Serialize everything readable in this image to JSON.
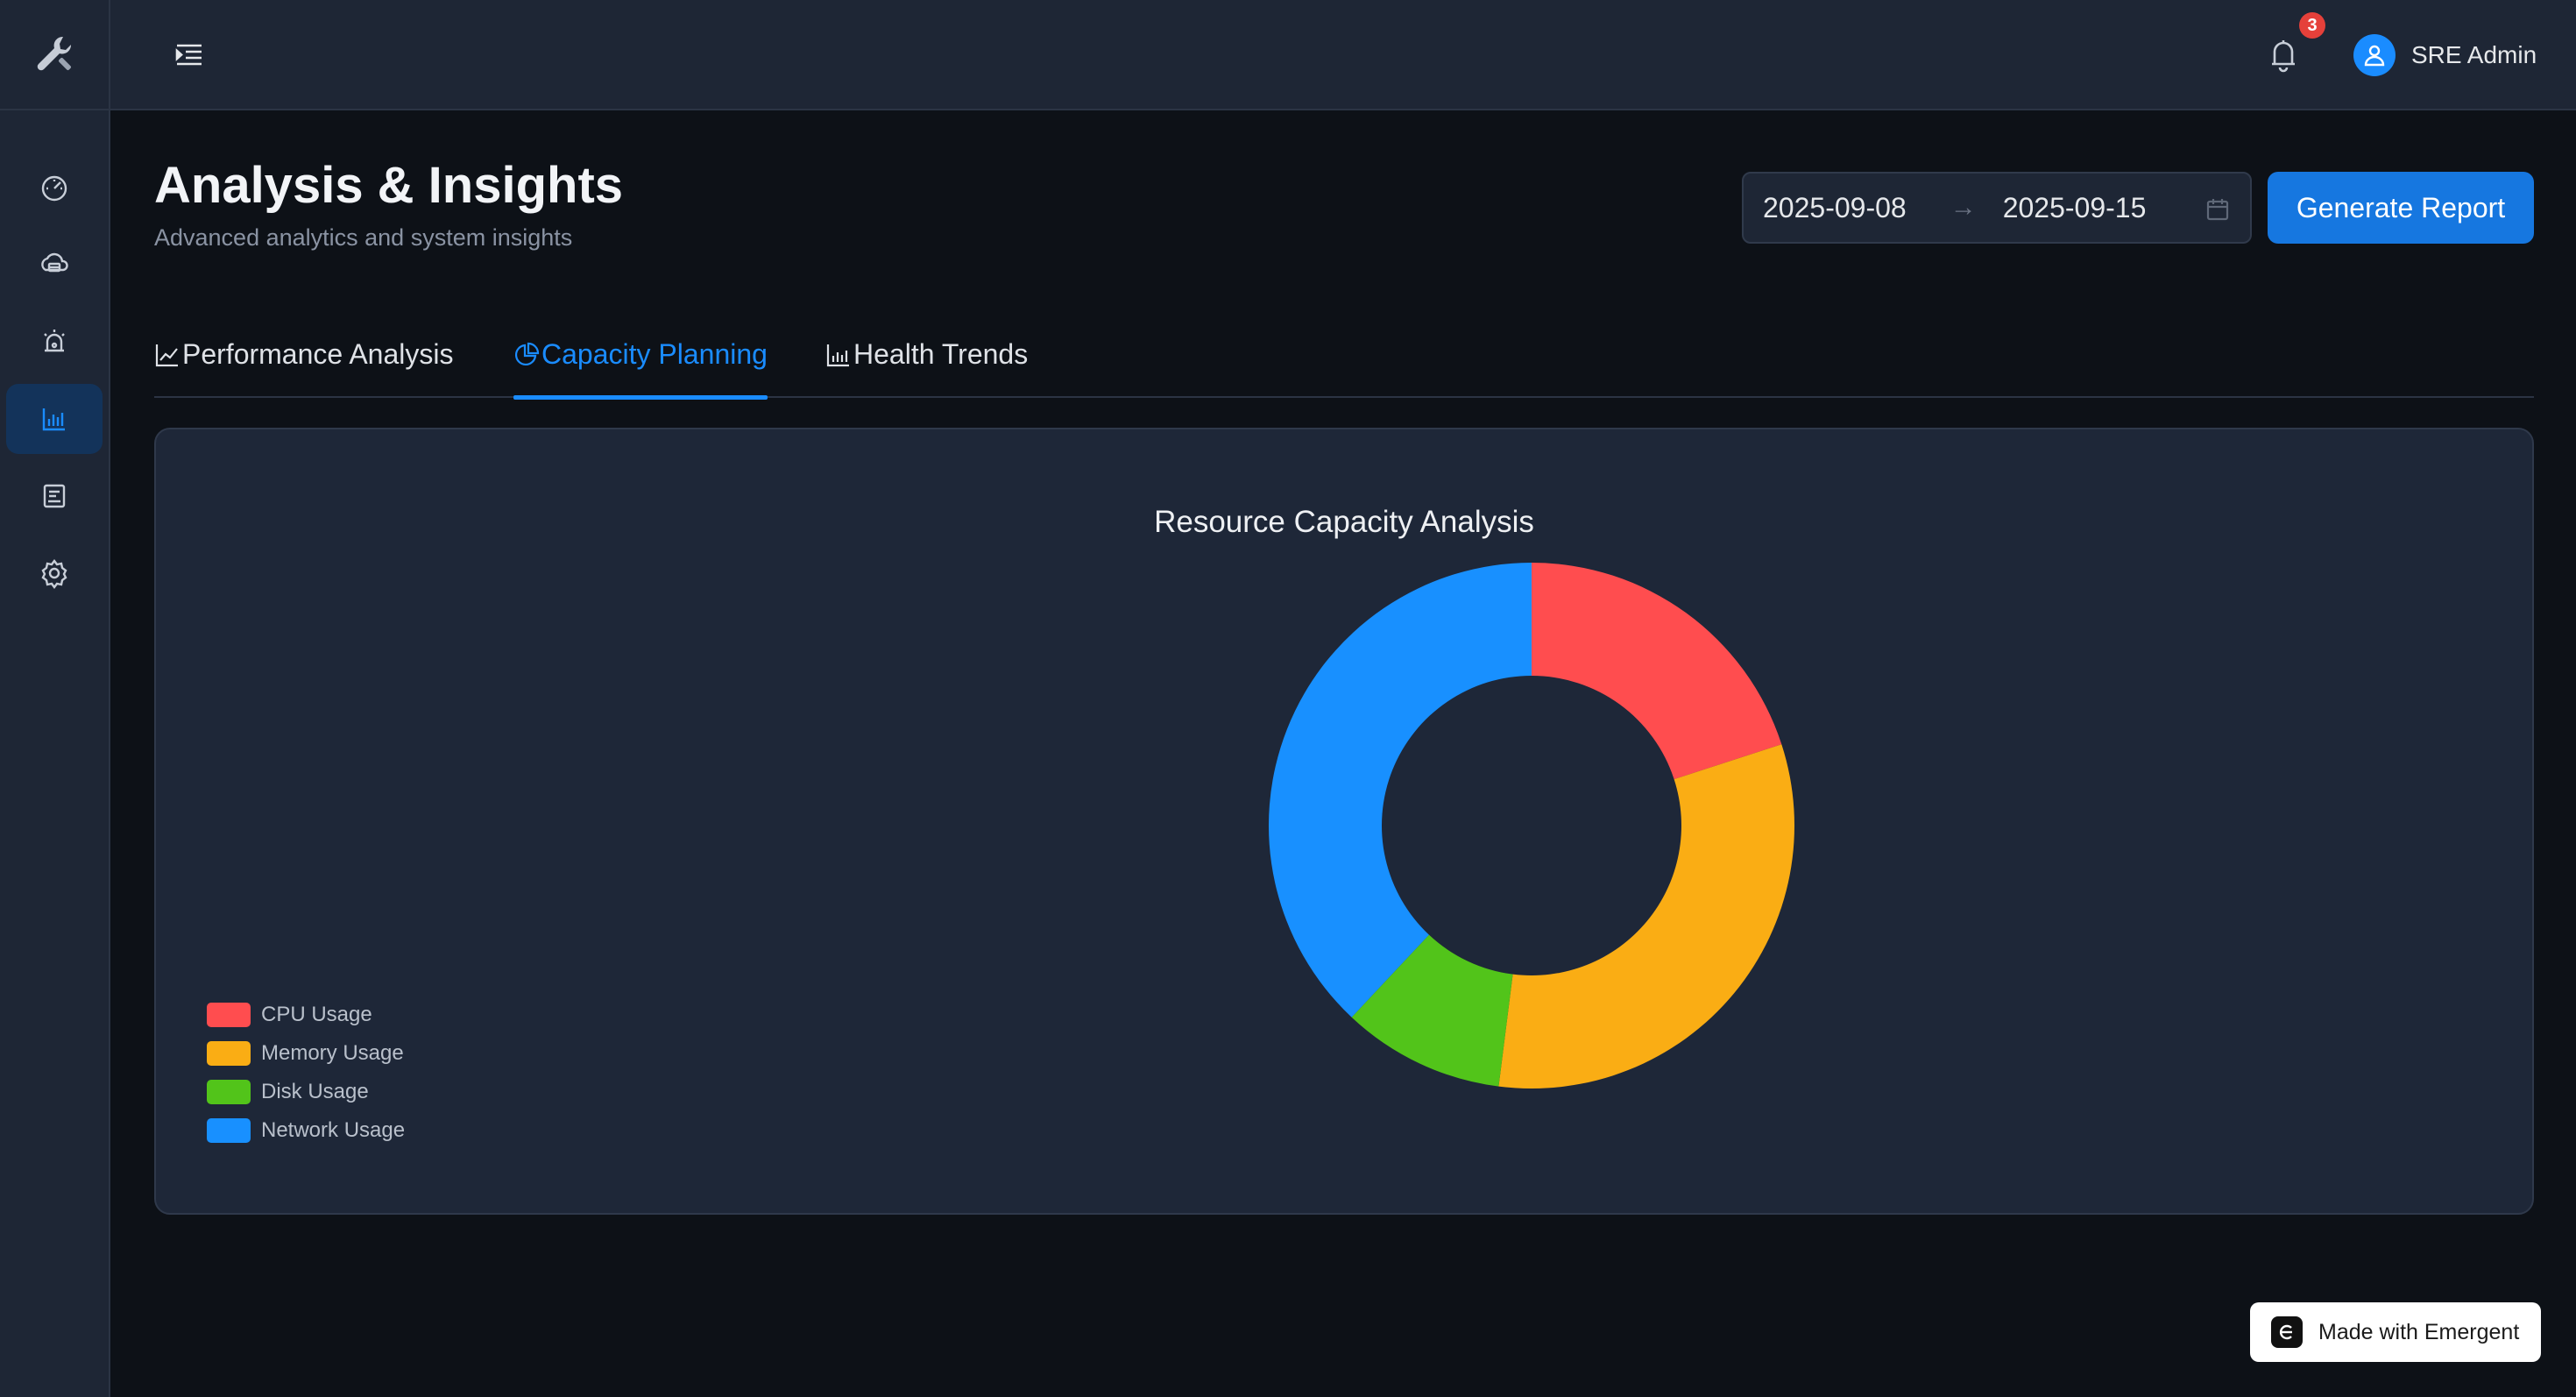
{
  "header": {
    "notification_count": "3",
    "user_name": "SRE Admin"
  },
  "sidebar": {
    "items": [
      {
        "icon": "dashboard-icon",
        "active": false
      },
      {
        "icon": "cloud-services-icon",
        "active": false
      },
      {
        "icon": "alarm-icon",
        "active": false
      },
      {
        "icon": "bar-chart-icon",
        "active": true
      },
      {
        "icon": "reports-icon",
        "active": false
      },
      {
        "icon": "gear-icon",
        "active": false
      }
    ]
  },
  "page": {
    "title": "Analysis & Insights",
    "subtitle": "Advanced analytics and system insights"
  },
  "date_range": {
    "start": "2025-09-08",
    "end": "2025-09-15"
  },
  "actions": {
    "generate_label": "Generate Report"
  },
  "tabs": [
    {
      "label": "Performance Analysis",
      "icon": "line-chart-icon",
      "active": false
    },
    {
      "label": "Capacity Planning",
      "icon": "pie-chart-icon",
      "active": true
    },
    {
      "label": "Health Trends",
      "icon": "bar-chart-icon",
      "active": false
    }
  ],
  "chart_data": {
    "type": "pie",
    "title": "Resource Capacity Analysis",
    "categories": [
      "CPU Usage",
      "Memory Usage",
      "Disk Usage",
      "Network Usage"
    ],
    "values": [
      20,
      32,
      10,
      38
    ],
    "colors": [
      "#ff4d4f",
      "#faad14",
      "#52c41a",
      "#1890ff"
    ],
    "legend_position": "bottom-left"
  },
  "footer": {
    "made_with": "Made with Emergent"
  },
  "colors": {
    "accent": "#1a8cff",
    "sidebar_bg": "#1e2635",
    "page_bg": "#0d1117",
    "card_bg": "#1e2738"
  }
}
